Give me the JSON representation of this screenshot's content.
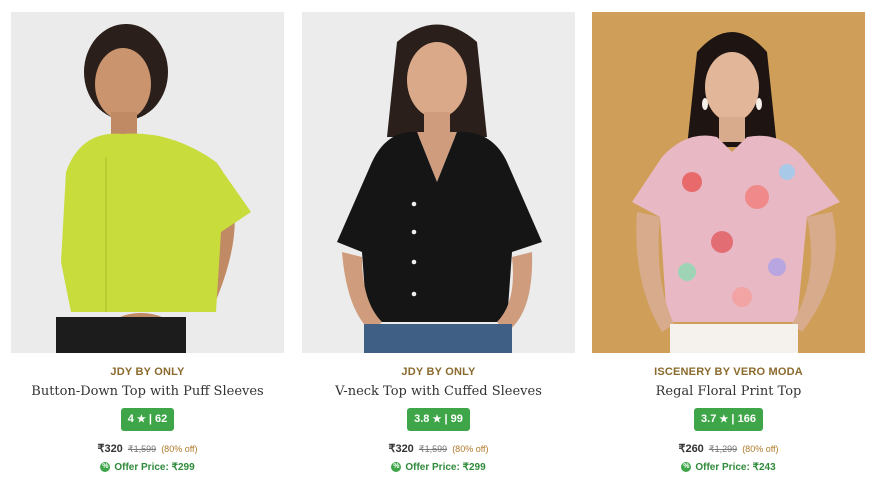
{
  "products": [
    {
      "brand": "JDY BY ONLY",
      "title": "Button-Down Top with Puff Sleeves",
      "rating": "4",
      "reviews": "62",
      "price": "₹320",
      "mrp": "₹1,599",
      "discount": "(80% off)",
      "offer_label": "Offer Price: ₹299",
      "bg_color": "#ebebeb",
      "garment_color": "#c8dc3c"
    },
    {
      "brand": "JDY BY ONLY",
      "title": "V-neck Top with Cuffed Sleeves",
      "rating": "3.8",
      "reviews": "99",
      "price": "₹320",
      "mrp": "₹1,599",
      "discount": "(80% off)",
      "offer_label": "Offer Price: ₹299",
      "bg_color": "#ececec",
      "garment_color": "#151515"
    },
    {
      "brand": "ISCENERY BY VERO MODA",
      "title": "Regal Floral Print Top",
      "rating": "3.7",
      "reviews": "166",
      "price": "₹260",
      "mrp": "₹1,299",
      "discount": "(80% off)",
      "offer_label": "Offer Price: ₹243",
      "bg_color": "#cf9f5a",
      "garment_color": "#e8b8c4"
    }
  ],
  "icons": {
    "star": "star-icon",
    "offer": "offer-tag-icon"
  },
  "colors": {
    "brand_text": "#8a6a2d",
    "rating_badge": "#3ea649",
    "offer_text": "#2f8a3a"
  }
}
